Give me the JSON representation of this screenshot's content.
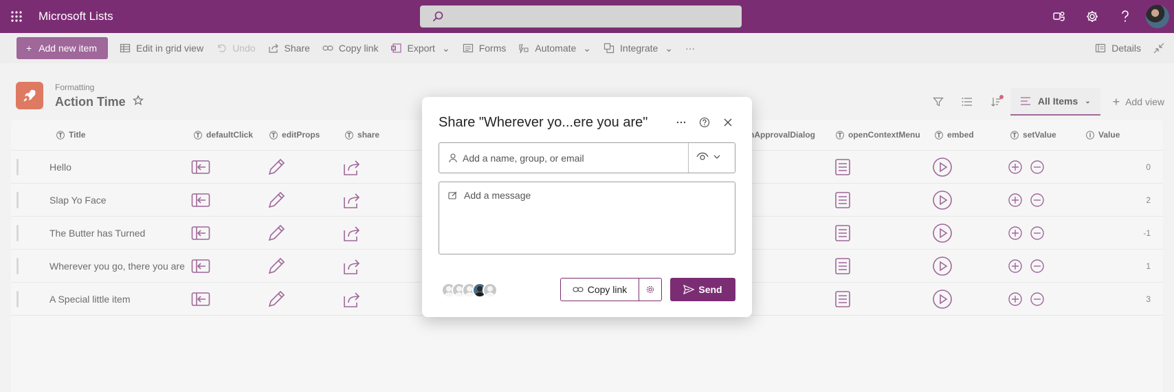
{
  "app": {
    "name": "Microsoft Lists"
  },
  "search": {
    "placeholder": ""
  },
  "colors": {
    "brand": "#7b2d74",
    "list_icon": "#d24726"
  },
  "topbar_icons": [
    "waffle-icon",
    "search-icon",
    "teams-icon",
    "gear-icon",
    "help-icon",
    "avatar"
  ],
  "commandbar": {
    "add_new": "Add new item",
    "edit_grid": "Edit in grid view",
    "undo": "Undo",
    "share": "Share",
    "copy_link": "Copy link",
    "export": "Export",
    "forms": "Forms",
    "automate": "Automate",
    "integrate": "Integrate",
    "more": "···",
    "details": "Details"
  },
  "list": {
    "breadcrumb": "Formatting",
    "title": "Action Time",
    "view": "All Items",
    "add_view": "Add view"
  },
  "columns": {
    "title": "Title",
    "defaultClick": "defaultClick",
    "editProps": "editProps",
    "share": "share",
    "approval": "nApprovalDialog",
    "openContextMenu": "openContextMenu",
    "embed": "embed",
    "setValue": "setValue",
    "value": "Value"
  },
  "rows": [
    {
      "title": "Hello",
      "value": "0"
    },
    {
      "title": "Slap Yo Face",
      "value": "2"
    },
    {
      "title": "The Butter has Turned",
      "value": "-1"
    },
    {
      "title": "Wherever you go, there you are",
      "value": "1"
    },
    {
      "title": "A Special little item",
      "value": "3"
    }
  ],
  "dialog": {
    "title": "Share \"Wherever yo...ere you are\"",
    "recipient_placeholder": "Add a name, group, or email",
    "message_placeholder": "Add a message",
    "copy_link": "Copy link",
    "send": "Send"
  }
}
